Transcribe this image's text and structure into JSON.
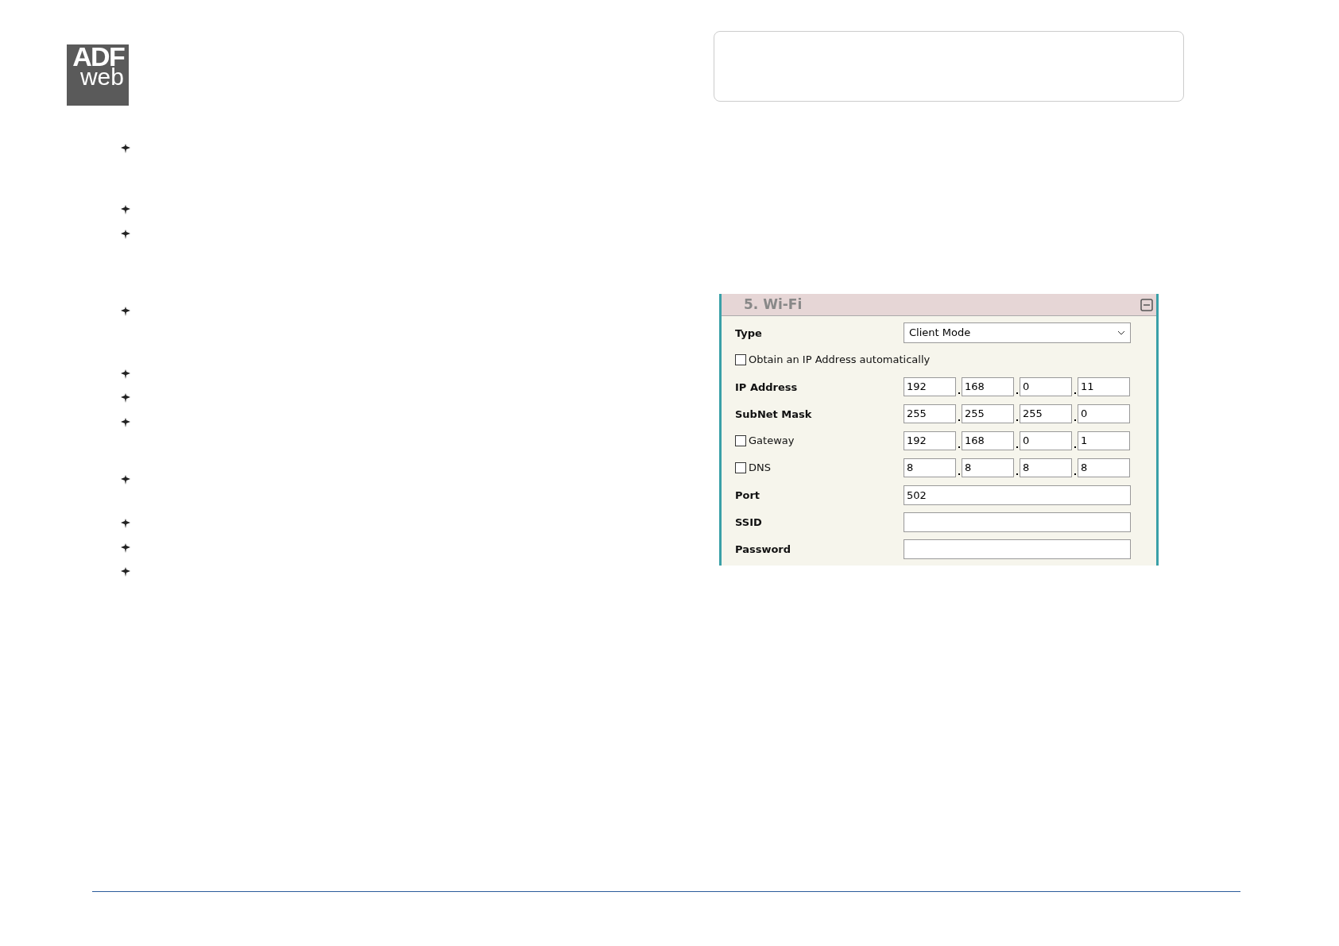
{
  "logo": {
    "line_1": "ADF",
    "line_2": "web"
  },
  "wifi_panel": {
    "title": "5. Wi-Fi",
    "rows": [
      {
        "kind": "select",
        "label": "Type",
        "value": "Client Mode"
      },
      {
        "kind": "checkbox",
        "label": "Obtain an IP Address automatically",
        "checked": false
      },
      {
        "kind": "ip",
        "label": "IP Address",
        "octets": [
          "192",
          "168",
          "0",
          "11"
        ]
      },
      {
        "kind": "ip",
        "label": "SubNet Mask",
        "octets": [
          "255",
          "255",
          "255",
          "0"
        ]
      },
      {
        "kind": "check_ip",
        "label": "Gateway",
        "checked": false,
        "octets": [
          "192",
          "168",
          "0",
          "1"
        ]
      },
      {
        "kind": "check_ip",
        "label": "DNS",
        "checked": false,
        "octets": [
          "8",
          "8",
          "8",
          "8"
        ]
      },
      {
        "kind": "text",
        "label": "Port",
        "value": "502"
      },
      {
        "kind": "text",
        "label": "SSID"
      },
      {
        "kind": "text",
        "label": "Password"
      }
    ]
  }
}
